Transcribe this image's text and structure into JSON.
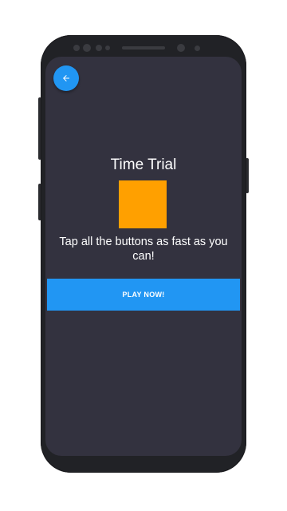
{
  "app": {
    "title": "Time Trial",
    "instructions": "Tap all the buttons as fast as you can!",
    "play_label": "PLAY NOW!"
  },
  "header": {
    "back_icon": "arrow-left-icon"
  },
  "colors": {
    "screen_background": "#33323f",
    "accent_blue": "#2196f3",
    "target_orange": "#ffa000",
    "text": "#ffffff"
  }
}
